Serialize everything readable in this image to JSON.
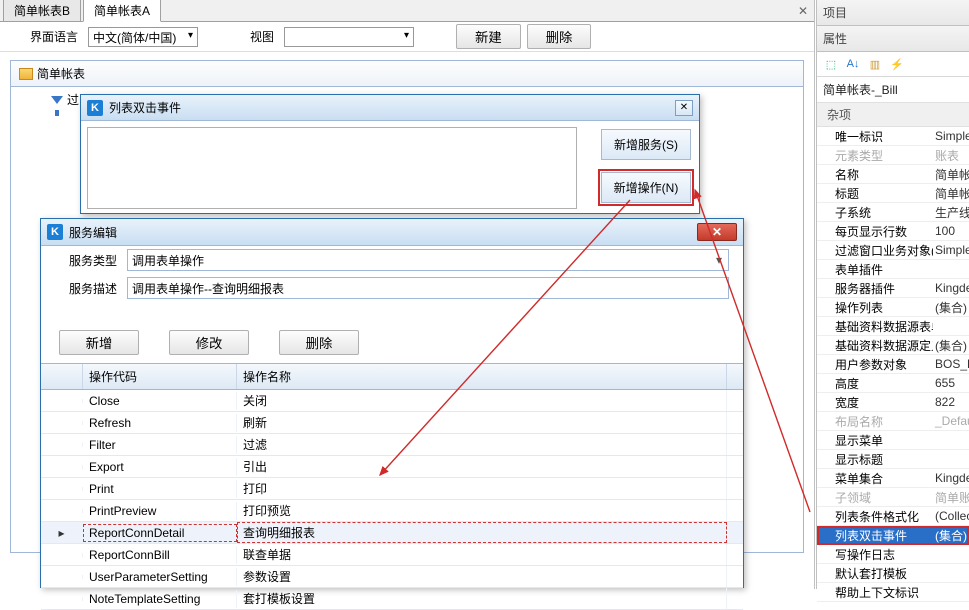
{
  "tabs": {
    "tabB": "简单帐表B",
    "tabA": "简单帐表A"
  },
  "toolbar": {
    "uiLangLabel": "界面语言",
    "uiLangValue": "中文(简体/中国)",
    "viewLabel": "视图",
    "viewValue": "",
    "newBtn": "新建",
    "deleteBtn": "删除"
  },
  "panel": {
    "title": "简单帐表",
    "filterLabel": "过"
  },
  "dblclick": {
    "title": "列表双击事件",
    "addService": "新增服务(S)",
    "addOperation": "新增操作(N)"
  },
  "service": {
    "title": "服务编辑",
    "typeLabel": "服务类型",
    "typeValue": "调用表单操作",
    "descLabel": "服务描述",
    "descValue": "调用表单操作--查询明细报表",
    "addBtn": "新增",
    "editBtn": "修改",
    "deleteBtn": "删除",
    "gridHeaders": {
      "code": "操作代码",
      "name": "操作名称"
    },
    "rows": [
      {
        "code": "Close",
        "name": "关闭"
      },
      {
        "code": "Refresh",
        "name": "刷新"
      },
      {
        "code": "Filter",
        "name": "过滤"
      },
      {
        "code": "Export",
        "name": "引出"
      },
      {
        "code": "Print",
        "name": "打印"
      },
      {
        "code": "PrintPreview",
        "name": "打印预览"
      },
      {
        "code": "ReportConnDetail",
        "name": "查询明细报表"
      },
      {
        "code": "ReportConnBill",
        "name": "联查单据"
      },
      {
        "code": "UserParameterSetting",
        "name": "参数设置"
      },
      {
        "code": "NoteTemplateSetting",
        "name": "套打模板设置"
      }
    ],
    "selectedIndex": 6
  },
  "right": {
    "projectHeader": "项目",
    "propHeader": "属性",
    "object": "简单帐表-_Bill",
    "category": "杂项",
    "props": [
      {
        "k": "唯一标识",
        "v": "SimpleRpt"
      },
      {
        "k": "元素类型",
        "v": "账表",
        "muted": true
      },
      {
        "k": "名称",
        "v": "简单帐表A"
      },
      {
        "k": "标题",
        "v": "简单帐表"
      },
      {
        "k": "子系统",
        "v": "生产线生产"
      },
      {
        "k": "每页显示行数",
        "v": "100"
      },
      {
        "k": "过滤窗口业务对象(报表)",
        "v": "SimpleRpt"
      },
      {
        "k": "表单插件",
        "v": ""
      },
      {
        "k": "服务器插件",
        "v": "Kingdee.K"
      },
      {
        "k": "操作列表",
        "v": "(集合)"
      },
      {
        "k": "基础资料数据源表单",
        "v": ""
      },
      {
        "k": "基础资料数据源定义",
        "v": "(集合)"
      },
      {
        "k": "用户参数对象",
        "v": "BOS_Repo"
      },
      {
        "k": "高度",
        "v": "655"
      },
      {
        "k": "宽度",
        "v": "822"
      },
      {
        "k": "布局名称",
        "v": "_Default",
        "muted": true
      },
      {
        "k": "显示菜单",
        "v": ""
      },
      {
        "k": "显示标题",
        "v": ""
      },
      {
        "k": "菜单集合",
        "v": "Kingdee.B"
      },
      {
        "k": "子领域",
        "v": "简单账表",
        "muted": true
      },
      {
        "k": "列表条件格式化",
        "v": "(Collection"
      },
      {
        "k": "列表双击事件",
        "v": "(集合)",
        "selected": true,
        "boxed": true
      },
      {
        "k": "写操作日志",
        "v": ""
      },
      {
        "k": "默认套打模板",
        "v": ""
      },
      {
        "k": "帮助上下文标识",
        "v": ""
      }
    ]
  }
}
